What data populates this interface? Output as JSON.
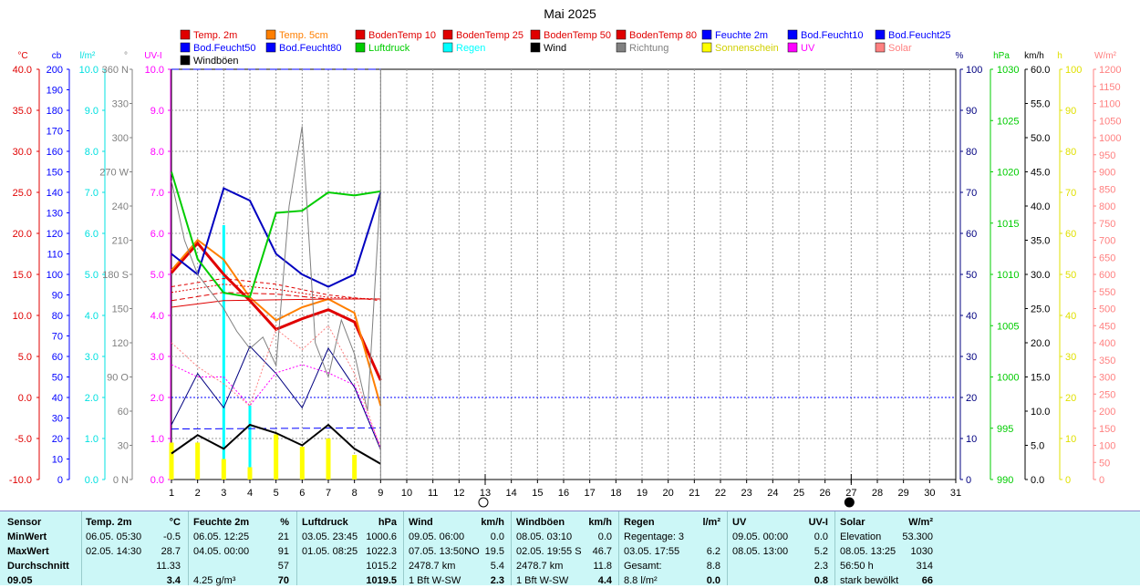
{
  "chart_data": {
    "type": "line",
    "title": "Mai 2025",
    "x_ticks": [
      "1",
      "2",
      "3",
      "4",
      "5",
      "6",
      "7",
      "8",
      "9",
      "10",
      "11",
      "12",
      "13",
      "14",
      "15",
      "16",
      "17",
      "18",
      "19",
      "20",
      "21",
      "22",
      "23",
      "24",
      "25",
      "26",
      "27",
      "28",
      "29",
      "30",
      "31"
    ],
    "xlim": [
      1,
      31
    ],
    "legend": [
      {
        "label": "Temp. 2m",
        "color": "#e00000"
      },
      {
        "label": "Temp. 5cm",
        "color": "#ff7f00"
      },
      {
        "label": "BodenTemp 10",
        "color": "#e00000"
      },
      {
        "label": "BodenTemp 25",
        "color": "#e00000"
      },
      {
        "label": "BodenTemp 50",
        "color": "#e00000"
      },
      {
        "label": "BodenTemp 80",
        "color": "#e00000"
      },
      {
        "label": "Feuchte 2m",
        "color": "#0000ff"
      },
      {
        "label": "Bod.Feucht10",
        "color": "#0000ff"
      },
      {
        "label": "Bod.Feucht25",
        "color": "#0000ff"
      },
      {
        "label": "Bod.Feucht50",
        "color": "#0000ff"
      },
      {
        "label": "Bod.Feucht80",
        "color": "#0000ff"
      },
      {
        "label": "Luftdruck",
        "color": "#00cc00"
      },
      {
        "label": "Regen",
        "color": "#00ffff"
      },
      {
        "label": "Wind",
        "color": "#000000"
      },
      {
        "label": "Richtung",
        "color": "#808080"
      },
      {
        "label": "Sonnenschein",
        "color": "#ffff00"
      },
      {
        "label": "UV",
        "color": "#ff00ff"
      },
      {
        "label": "Solar",
        "color": "#ff8080"
      },
      {
        "label": "Windböen",
        "color": "#000000"
      }
    ],
    "axes": {
      "temp": {
        "unit": "°C",
        "color": "#e00000",
        "ticks": [
          "40.0",
          "35.0",
          "30.0",
          "25.0",
          "20.0",
          "15.0",
          "10.0",
          "5.0",
          "0.0",
          "-5.0",
          "-10.0"
        ]
      },
      "cb": {
        "unit": "cb",
        "color": "#0000ff",
        "ticks": [
          "200",
          "190",
          "180",
          "170",
          "160",
          "150",
          "140",
          "130",
          "120",
          "110",
          "100",
          "90",
          "80",
          "70",
          "60",
          "50",
          "40",
          "30",
          "20",
          "10",
          "0"
        ]
      },
      "rain": {
        "unit": "l/m²",
        "color": "#00e0e0",
        "ticks": [
          "10.0",
          "9.0",
          "8.0",
          "7.0",
          "6.0",
          "5.0",
          "4.0",
          "3.0",
          "2.0",
          "1.0",
          "0.0"
        ]
      },
      "dir": {
        "unit": "°",
        "color": "#808080",
        "ticks": [
          "360 N",
          "330",
          "300",
          "270 W",
          "240",
          "210",
          "180 S",
          "150",
          "120",
          "90 O",
          "60",
          "30",
          "0 N"
        ]
      },
      "uv": {
        "unit": "UV-I",
        "color": "#ff00ff",
        "ticks": [
          "10.0",
          "9.0",
          "8.0",
          "7.0",
          "6.0",
          "5.0",
          "4.0",
          "3.0",
          "2.0",
          "1.0",
          "0.0"
        ]
      },
      "hum": {
        "unit": "%",
        "color": "#000080",
        "ticks": [
          "100",
          "90",
          "80",
          "70",
          "60",
          "50",
          "40",
          "30",
          "20",
          "10",
          "0"
        ]
      },
      "pres": {
        "unit": "hPa",
        "color": "#00cc00",
        "ticks": [
          "1030",
          "1025",
          "1020",
          "1015",
          "1010",
          "1005",
          "1000",
          "995",
          "990"
        ]
      },
      "wind": {
        "unit": "km/h",
        "color": "#000000",
        "ticks": [
          "60.0",
          "55.0",
          "50.0",
          "45.0",
          "40.0",
          "35.0",
          "30.0",
          "25.0",
          "20.0",
          "15.0",
          "10.0",
          "5.0",
          "0.0"
        ]
      },
      "sun": {
        "unit": "h",
        "color": "#e0e000",
        "ticks": [
          "100",
          "90",
          "80",
          "70",
          "60",
          "50",
          "40",
          "30",
          "20",
          "10",
          "0"
        ]
      },
      "solar": {
        "unit": "W/m²",
        "color": "#ff8080",
        "ticks": [
          "1200",
          "1150",
          "1100",
          "1050",
          "1000",
          "950",
          "900",
          "850",
          "800",
          "750",
          "700",
          "650",
          "600",
          "550",
          "500",
          "450",
          "400",
          "350",
          "300",
          "250",
          "200",
          "150",
          "100",
          "50",
          "0"
        ]
      }
    },
    "series": [
      {
        "name": "Temp. 2m",
        "axis": "temp",
        "color": "#e00000",
        "width": 3,
        "x": [
          1,
          2,
          3,
          4,
          5,
          6,
          7,
          8,
          9
        ],
        "values": [
          15.2,
          18.8,
          15.0,
          11.8,
          8.3,
          9.6,
          10.7,
          9.2,
          2.1
        ]
      },
      {
        "name": "Temp. 5cm",
        "axis": "temp",
        "color": "#ff7f00",
        "width": 2,
        "x": [
          1,
          2,
          3,
          4,
          5,
          6,
          7,
          8,
          9
        ],
        "values": [
          15.5,
          19.2,
          16.8,
          12.2,
          9.4,
          11.0,
          12.0,
          10.3,
          -1.0
        ]
      },
      {
        "name": "BodenTemp 10",
        "axis": "temp",
        "color": "#e00000",
        "width": 1,
        "dash": "4,3",
        "x": [
          1,
          3,
          5,
          7,
          9
        ],
        "values": [
          13.5,
          14.5,
          13.8,
          12.5,
          11.8
        ]
      },
      {
        "name": "BodenTemp 25",
        "axis": "temp",
        "color": "#e00000",
        "width": 1,
        "dash": "2,2",
        "x": [
          1,
          3,
          5,
          7,
          9
        ],
        "values": [
          12.8,
          13.8,
          13.2,
          12.2,
          12.0
        ]
      },
      {
        "name": "BodenTemp 50",
        "axis": "temp",
        "color": "#e00000",
        "width": 1,
        "dash": "6,3",
        "x": [
          1,
          3,
          5,
          7,
          9
        ],
        "values": [
          11.8,
          12.8,
          12.6,
          12.0,
          12.0
        ]
      },
      {
        "name": "BodenTemp 80",
        "axis": "temp",
        "color": "#e00000",
        "width": 1,
        "x": [
          1,
          3,
          5,
          7,
          9
        ],
        "values": [
          11.0,
          11.8,
          11.9,
          12.0,
          12.0
        ]
      },
      {
        "name": "Feuchte 2m",
        "axis": "hum",
        "color": "#0000c0",
        "width": 2,
        "x": [
          1,
          2,
          3,
          4,
          5,
          6,
          7,
          8,
          9
        ],
        "values": [
          55,
          50,
          71,
          68,
          55,
          50,
          47,
          50,
          70
        ]
      },
      {
        "name": "Bod.Feucht80",
        "axis": "hum",
        "color": "#0000ff",
        "width": 1,
        "dash": "8,4",
        "x": [
          1,
          9
        ],
        "values": [
          100,
          100
        ]
      },
      {
        "name": "Bod.Feucht50",
        "axis": "hum",
        "color": "#0000ff",
        "width": 1,
        "dash": "8,4",
        "x": [
          1,
          9
        ],
        "values": [
          12.3,
          12.6
        ]
      },
      {
        "name": "Luftdruck",
        "axis": "pres",
        "color": "#00cc00",
        "width": 2,
        "x": [
          1,
          2,
          3,
          4,
          5,
          6,
          7,
          8,
          9
        ],
        "values": [
          1020.0,
          1011.5,
          1008.2,
          1007.8,
          1016.0,
          1016.2,
          1018.0,
          1017.7,
          1018.1
        ]
      },
      {
        "name": "Wind",
        "axis": "wind",
        "color": "#000000",
        "width": 2,
        "x": [
          1,
          2,
          3,
          4,
          5,
          6,
          7,
          8,
          9
        ],
        "values": [
          3.8,
          6.5,
          4.5,
          8.0,
          6.8,
          5.0,
          8.0,
          4.5,
          2.3
        ]
      },
      {
        "name": "Windböen",
        "axis": "wind",
        "color": "#000080",
        "width": 1,
        "x": [
          1,
          2,
          3,
          4,
          5,
          6,
          7,
          8,
          9
        ],
        "values": [
          8.0,
          15.5,
          10.5,
          19.5,
          15.5,
          10.5,
          19.2,
          13.5,
          4.4
        ]
      },
      {
        "name": "Richtung",
        "axis": "dir",
        "color": "#808080",
        "width": 1,
        "x": [
          1,
          1.5,
          2,
          2.5,
          3,
          3.5,
          4,
          4.5,
          5,
          5.5,
          6,
          6.5,
          7,
          7.5,
          8,
          8.5,
          9
        ],
        "values": [
          262,
          210,
          180,
          165,
          150,
          130,
          115,
          125,
          100,
          240,
          310,
          120,
          90,
          140,
          110,
          60,
          255
        ]
      },
      {
        "name": "UV",
        "axis": "uv",
        "color": "#ff00ff",
        "width": 1,
        "dash": "2,2",
        "x": [
          1,
          2,
          3,
          4,
          5,
          6,
          7,
          8,
          9
        ],
        "values": [
          2.8,
          2.5,
          2.5,
          1.8,
          2.6,
          2.8,
          2.6,
          2.3,
          0.8
        ]
      },
      {
        "name": "Solar",
        "axis": "solar",
        "color": "#ff8080",
        "width": 1,
        "dash": "2,2",
        "x": [
          1,
          2,
          3,
          4,
          5,
          6,
          7,
          8,
          9
        ],
        "values": [
          400,
          330,
          280,
          215,
          440,
          380,
          450,
          310,
          90
        ]
      }
    ],
    "bars": [
      {
        "name": "Regen",
        "axis": "rain",
        "color": "#00ffff",
        "width": 3,
        "x": [
          3,
          4
        ],
        "values": [
          6.2,
          1.8
        ]
      },
      {
        "name": "Regen (Tag 2)",
        "axis": "rain",
        "color": "#00ffff",
        "width": 3,
        "x": [
          2
        ],
        "values": [
          0.8
        ]
      },
      {
        "name": "Sonnenschein",
        "axis": "sun",
        "color": "#ffff00",
        "width": 5,
        "x": [
          1,
          2,
          3,
          4,
          5,
          6,
          7,
          8
        ],
        "values": [
          9.0,
          9.0,
          5.0,
          3.0,
          11.0,
          8.0,
          10.0,
          6.0
        ]
      }
    ],
    "reference_lines": [
      {
        "axis": "hum",
        "value": 20,
        "color": "#0000ff",
        "dash": "2,2"
      }
    ],
    "moon_markers": [
      {
        "day": 13,
        "phase": "full"
      },
      {
        "day": 27,
        "phase": "new"
      }
    ]
  },
  "stats": {
    "columns": [
      {
        "rows": [
          "Sensor",
          "MinWert",
          "MaxWert",
          "Durchschnitt",
          "09.05"
        ]
      },
      {
        "head_label": "Temp. 2m",
        "head_unit": "°C",
        "rows": [
          [
            "06.05.  05:30",
            "-0.5"
          ],
          [
            "02.05.  14:30",
            "28.7"
          ],
          [
            "",
            "11.33"
          ],
          [
            "",
            "3.4"
          ]
        ]
      },
      {
        "head_label": "Feuchte 2m",
        "head_unit": "%",
        "rows": [
          [
            "06.05.  12:25",
            "21"
          ],
          [
            "04.05.  00:00",
            "91"
          ],
          [
            "",
            "57"
          ],
          [
            "4.25 g/m³",
            "70"
          ]
        ]
      },
      {
        "head_label": "Luftdruck",
        "head_unit": "hPa",
        "rows": [
          [
            "03.05.  23:45",
            "1000.6"
          ],
          [
            "01.05.  08:25",
            "1022.3"
          ],
          [
            "",
            "1015.2"
          ],
          [
            "",
            "1019.5"
          ]
        ]
      },
      {
        "head_label": "Wind",
        "head_unit": "km/h",
        "rows": [
          [
            "09.05.  06:00",
            "0.0"
          ],
          [
            "07.05.  13:50NO",
            "19.5"
          ],
          [
            "2478.7 km",
            "5.4"
          ],
          [
            "1 Bft W-SW",
            "2.3"
          ]
        ]
      },
      {
        "head_label": "Windböen",
        "head_unit": "km/h",
        "rows": [
          [
            "08.05.  03:10",
            "0.0"
          ],
          [
            "02.05.  19:55  S",
            "46.7"
          ],
          [
            "2478.7 km",
            "11.8"
          ],
          [
            "1 Bft W-SW",
            "4.4"
          ]
        ]
      },
      {
        "head_label": "Regen",
        "head_unit": "l/m²",
        "rows": [
          [
            "Regentage: 3",
            ""
          ],
          [
            "03.05.  17:55",
            "6.2"
          ],
          [
            "Gesamt:",
            "8.8"
          ],
          [
            "8.8 l/m²",
            "0.0"
          ]
        ]
      },
      {
        "head_label": "UV",
        "head_unit": "UV-I",
        "rows": [
          [
            "09.05.  00:00",
            "0.0"
          ],
          [
            "08.05.  13:00",
            "5.2"
          ],
          [
            "",
            "2.3"
          ],
          [
            "",
            "0.8"
          ]
        ]
      },
      {
        "head_label": "Solar",
        "head_unit": "W/m²",
        "rows": [
          [
            "Elevation",
            "53.300"
          ],
          [
            "08.05.  13:25",
            "1030"
          ],
          [
            "56:50 h",
            "314"
          ],
          [
            "stark bewölkt",
            "66"
          ]
        ]
      }
    ]
  }
}
